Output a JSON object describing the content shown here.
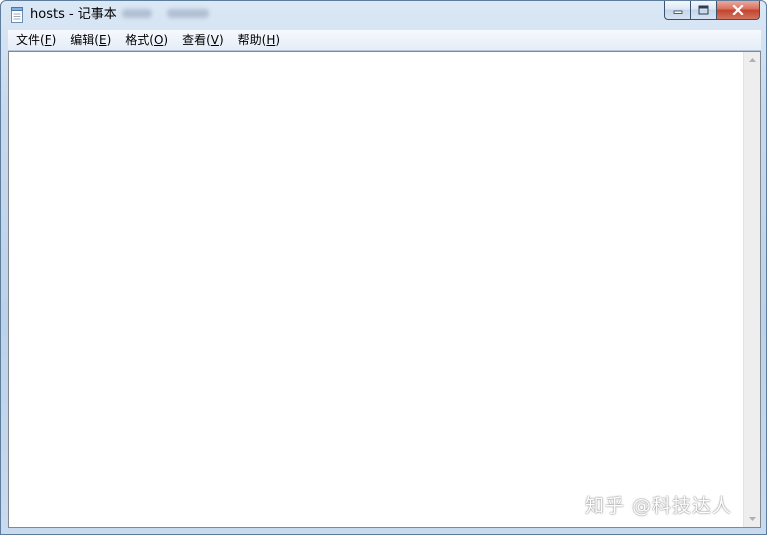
{
  "window": {
    "title": "hosts - 记事本",
    "icon": "notepad-icon",
    "caption_buttons": {
      "minimize": "minimize-icon",
      "maximize": "maximize-icon",
      "close": "close-icon"
    }
  },
  "menubar": {
    "items": [
      {
        "label": "文件(",
        "accel": "F",
        "suffix": ")"
      },
      {
        "label": "编辑(",
        "accel": "E",
        "suffix": ")"
      },
      {
        "label": "格式(",
        "accel": "O",
        "suffix": ")"
      },
      {
        "label": "查看(",
        "accel": "V",
        "suffix": ")"
      },
      {
        "label": "帮助(",
        "accel": "H",
        "suffix": ")"
      }
    ]
  },
  "editor": {
    "content": ""
  },
  "watermark": {
    "text": "知乎 @科技达人"
  },
  "colors": {
    "titlebar": "#c7d9ee",
    "close_button": "#c3432d",
    "editor_bg": "#ffffff"
  }
}
